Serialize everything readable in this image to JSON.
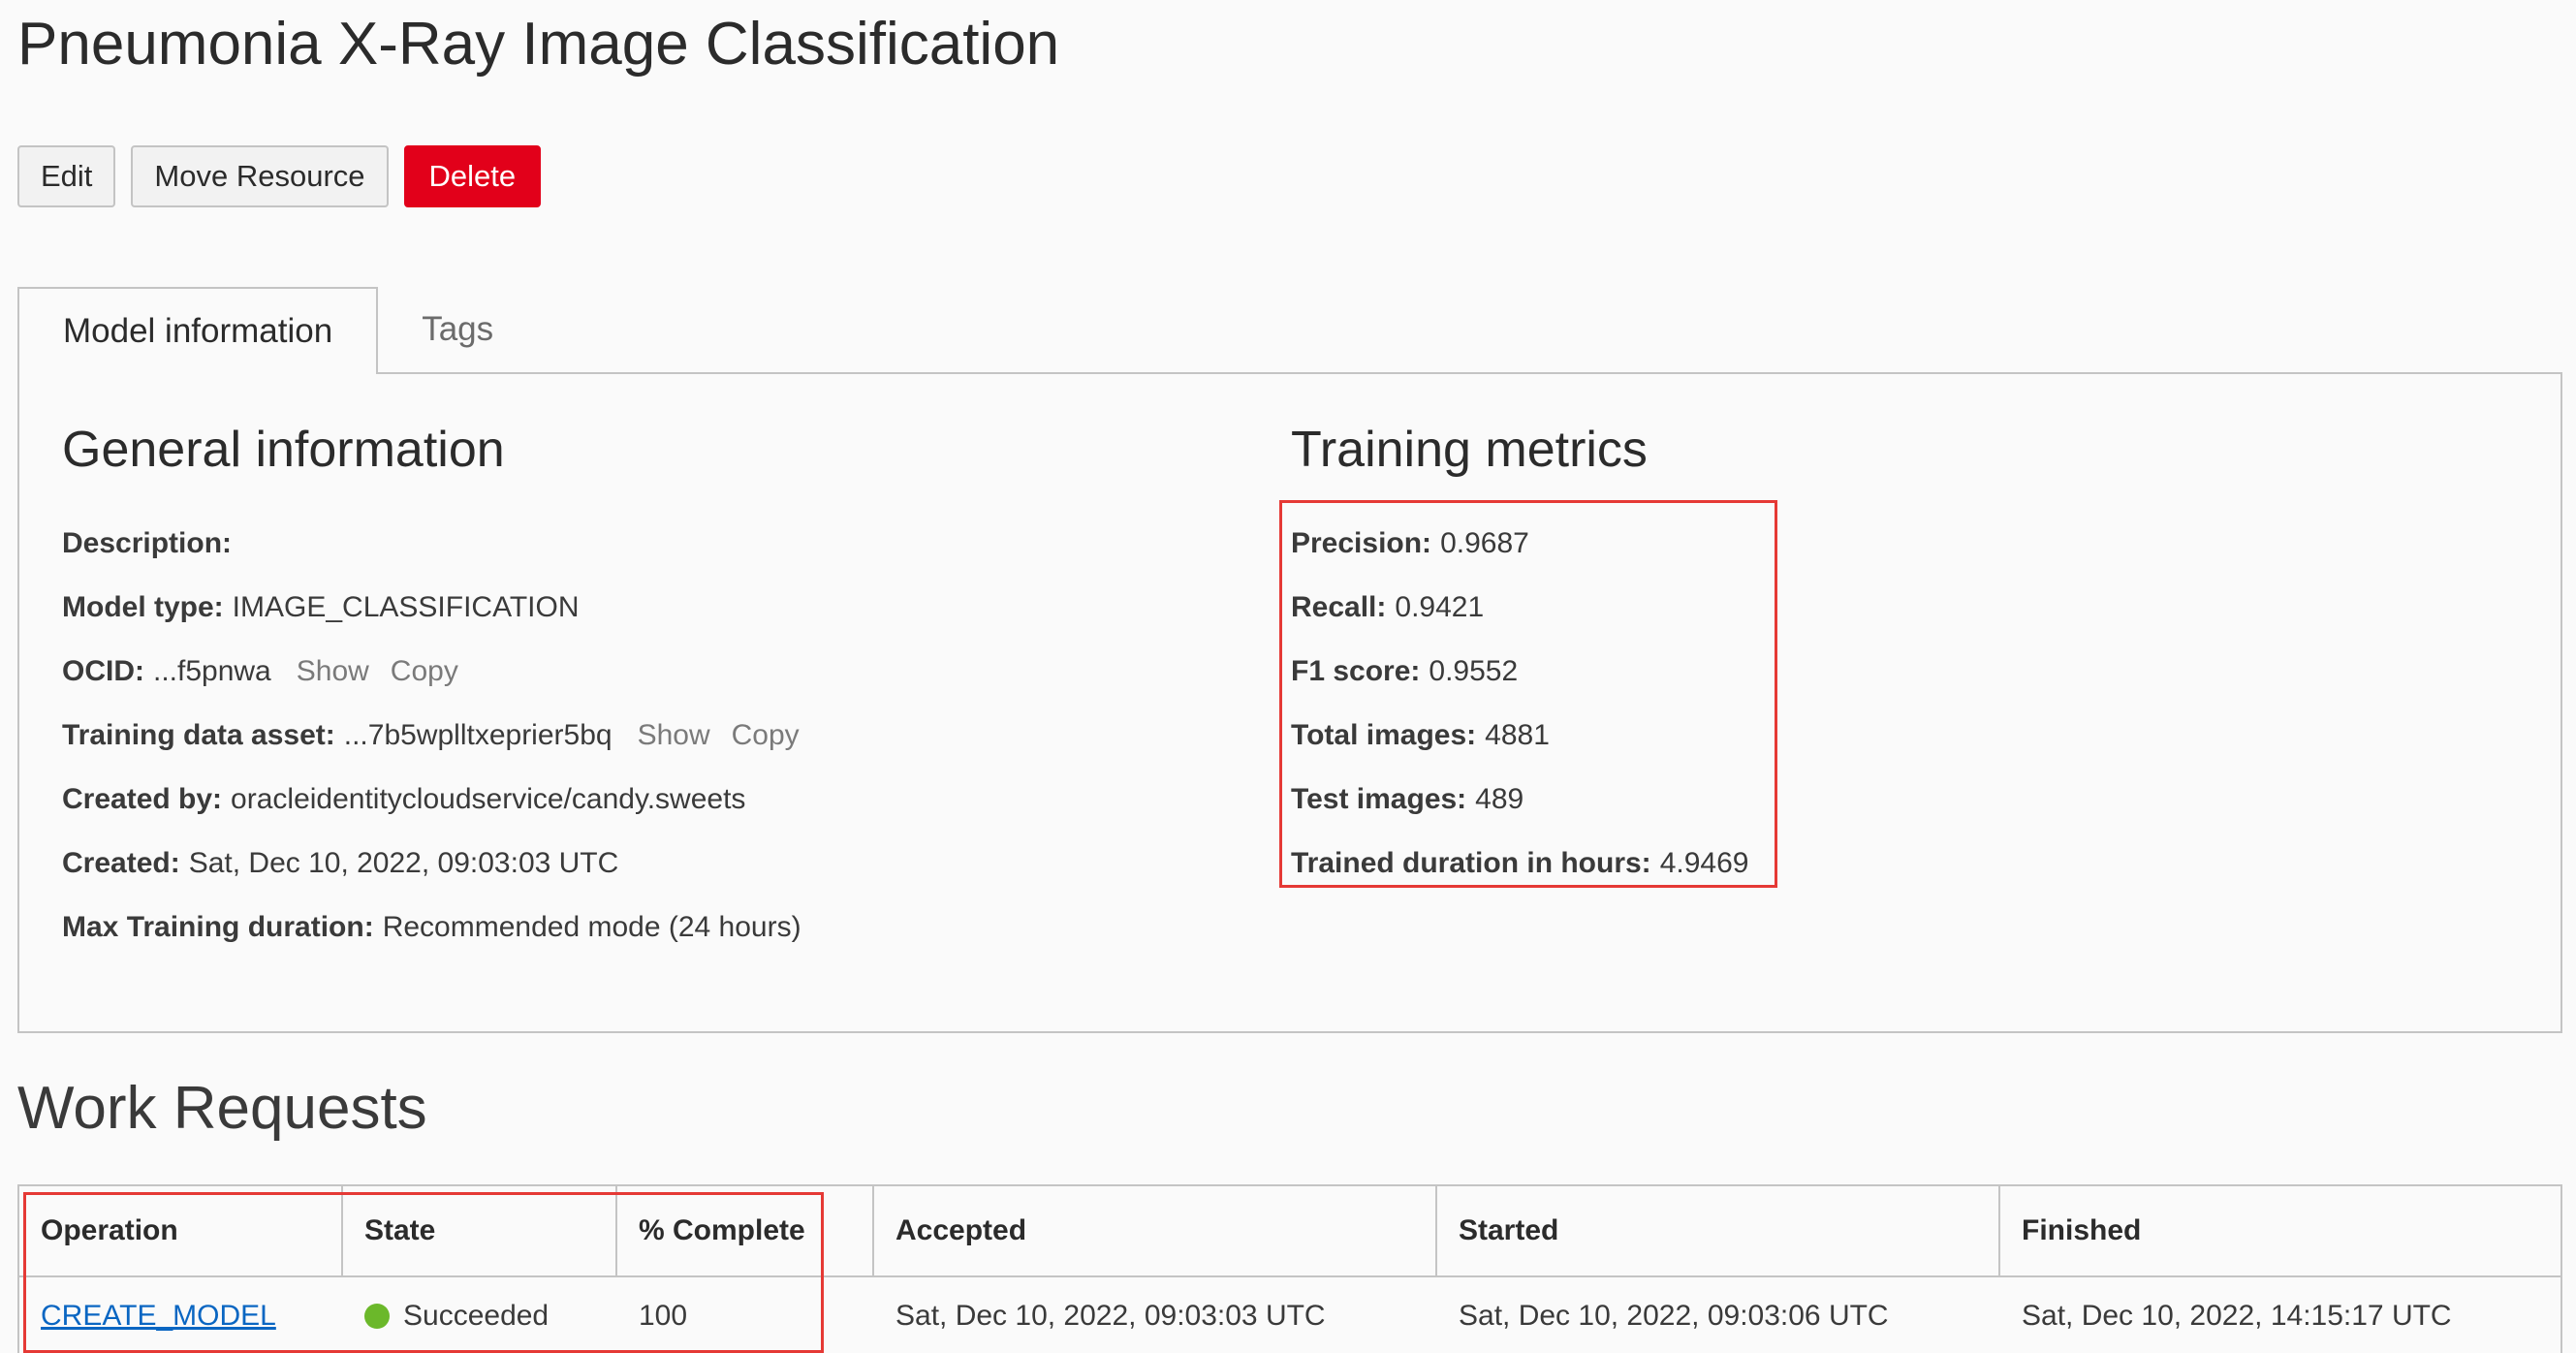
{
  "header": {
    "title": "Pneumonia X-Ray Image Classification"
  },
  "actions": {
    "edit": "Edit",
    "move": "Move Resource",
    "delete": "Delete"
  },
  "tabs": {
    "model_info": "Model information",
    "tags": "Tags"
  },
  "general": {
    "title": "General information",
    "description_label": "Description:",
    "description_value": "",
    "model_type_label": "Model type:",
    "model_type_value": "IMAGE_CLASSIFICATION",
    "ocid_label": "OCID:",
    "ocid_value": "...f5pnwa",
    "training_asset_label": "Training data asset:",
    "training_asset_value": "...7b5wplltxeprier5bq",
    "show": "Show",
    "copy": "Copy",
    "created_by_label": "Created by:",
    "created_by_value": "oracleidentitycloudservice/candy.sweets",
    "created_label": "Created:",
    "created_value": "Sat, Dec 10, 2022, 09:03:03 UTC",
    "max_duration_label": "Max Training duration:",
    "max_duration_value": "Recommended mode (24 hours)"
  },
  "metrics": {
    "title": "Training metrics",
    "precision_label": "Precision:",
    "precision_value": "0.9687",
    "recall_label": "Recall:",
    "recall_value": "0.9421",
    "f1_label": "F1 score:",
    "f1_value": "0.9552",
    "total_images_label": "Total images:",
    "total_images_value": "4881",
    "test_images_label": "Test images:",
    "test_images_value": "489",
    "duration_label": "Trained duration in hours:",
    "duration_value": "4.9469"
  },
  "work_requests": {
    "title": "Work Requests",
    "columns": {
      "operation": "Operation",
      "state": "State",
      "complete": "% Complete",
      "accepted": "Accepted",
      "started": "Started",
      "finished": "Finished"
    },
    "rows": [
      {
        "operation": "CREATE_MODEL",
        "state": "Succeeded",
        "complete": "100",
        "accepted": "Sat, Dec 10, 2022, 09:03:03 UTC",
        "started": "Sat, Dec 10, 2022, 09:03:06 UTC",
        "finished": "Sat, Dec 10, 2022, 14:15:17 UTC"
      }
    ]
  },
  "colors": {
    "danger": "#e2001a",
    "highlight": "#e53935",
    "link": "#0a66c2",
    "success": "#6bb82a"
  }
}
